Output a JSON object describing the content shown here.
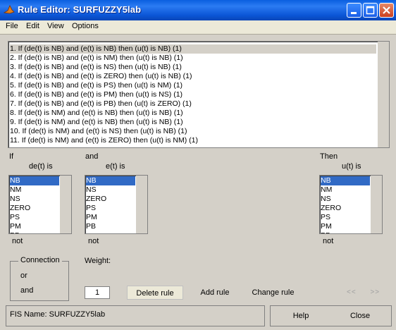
{
  "window": {
    "title": "Rule Editor: SURFUZZY5lab"
  },
  "menu": [
    "File",
    "Edit",
    "View",
    "Options"
  ],
  "rules": [
    "1. If (de(t) is NB) and (e(t) is NB) then (u(t) is NB) (1)",
    "2. If (de(t) is NB) and (e(t) is NM) then (u(t) is NB) (1)",
    "3. If (de(t) is NB) and (e(t) is NS) then (u(t) is NB) (1)",
    "4. If (de(t) is NB) and (e(t) is ZERO) then (u(t) is NB) (1)",
    "5. If (de(t) is NB) and (e(t) is PS) then (u(t) is NM) (1)",
    "6. If (de(t) is NB) and (e(t) is PM) then (u(t) is NS) (1)",
    "7. If (de(t) is NB) and (e(t) is PB) then (u(t) is ZERO) (1)",
    "8. If (de(t) is NM) and (e(t) is NB) then (u(t) is NB) (1)",
    "9. If (de(t) is NM) and (e(t) is NB) then (u(t) is NB) (1)",
    "10. If (de(t) is NM) and (e(t) is NS) then (u(t) is NB) (1)",
    "11. If (de(t) is NM) and (e(t) is ZERO) then (u(t) is NM) (1)"
  ],
  "if_label": "If",
  "and_label": "and",
  "then_label": "Then",
  "input1": {
    "name": "de(t) is",
    "options": [
      "NB",
      "NM",
      "NS",
      "ZERO",
      "PS",
      "PM",
      "PB"
    ],
    "not": "not"
  },
  "input2": {
    "name": "e(t) is",
    "options": [
      "NB",
      "NS",
      "ZERO",
      "PS",
      "PM",
      "PB"
    ],
    "not": "not"
  },
  "output": {
    "name": "u(t) is",
    "options": [
      "NB",
      "NM",
      "NS",
      "ZERO",
      "PS",
      "PM",
      "PB"
    ],
    "not": "not"
  },
  "connection": {
    "title": "Connection",
    "or": "or",
    "and": "and"
  },
  "weight": {
    "label": "Weight:",
    "value": "1"
  },
  "buttons": {
    "delete": "Delete rule",
    "add": "Add rule",
    "change": "Change rule",
    "help": "Help",
    "close": "Close"
  },
  "nav": {
    "prev": "<<",
    "next": ">>"
  },
  "status": "FIS Name: SURFUZZY5lab"
}
